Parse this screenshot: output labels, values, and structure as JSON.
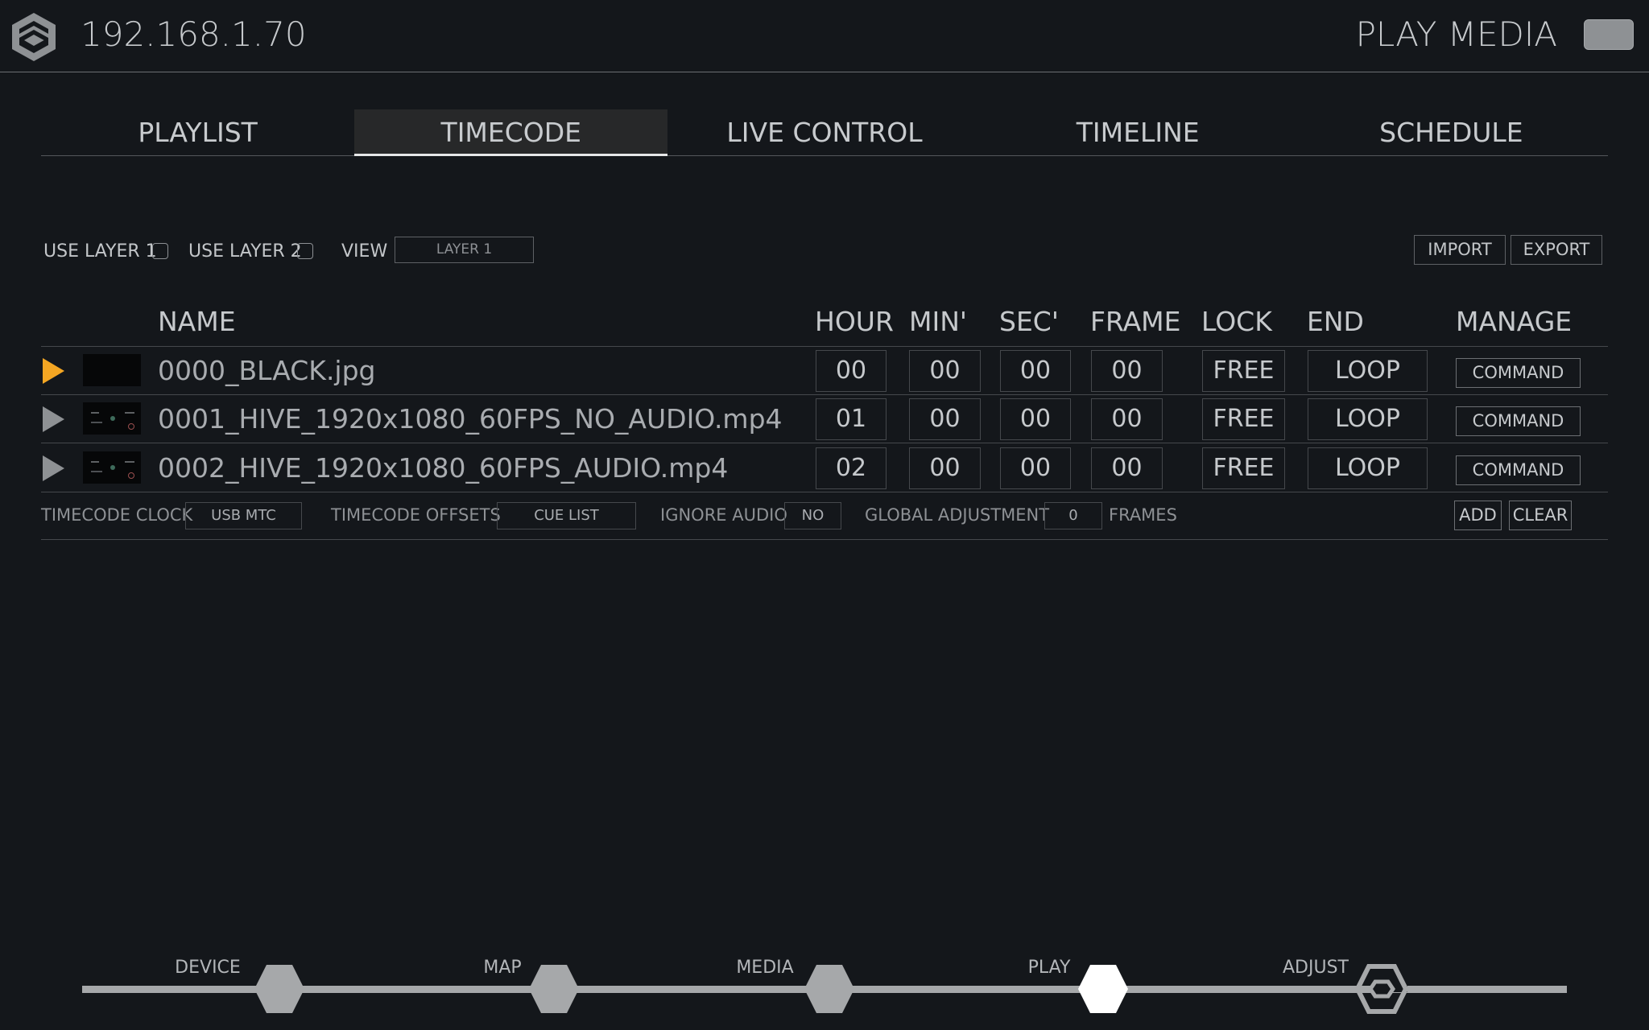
{
  "header": {
    "ip": "192.168.1.70",
    "title": "PLAY MEDIA"
  },
  "tabs": [
    {
      "label": "PLAYLIST",
      "active": false
    },
    {
      "label": "TIMECODE",
      "active": true
    },
    {
      "label": "LIVE CONTROL",
      "active": false
    },
    {
      "label": "TIMELINE",
      "active": false
    },
    {
      "label": "SCHEDULE",
      "active": false
    }
  ],
  "options": {
    "use_layer_1": "USE LAYER 1",
    "use_layer_2": "USE LAYER 2",
    "view_label": "VIEW",
    "view_value": "LAYER 1",
    "import": "IMPORT",
    "export": "EXPORT"
  },
  "table": {
    "headers": {
      "name": "NAME",
      "hour": "HOUR",
      "min": "MIN'",
      "sec": "SEC'",
      "frame": "FRAME",
      "lock": "LOCK",
      "end": "END",
      "manage": "MANAGE"
    },
    "rows": [
      {
        "name": "0000_BLACK.jpg",
        "hour": "00",
        "min": "00",
        "sec": "00",
        "frame": "00",
        "lock": "FREE",
        "end": "LOOP",
        "manage": "COMMAND",
        "playing": true
      },
      {
        "name": "0001_HIVE_1920x1080_60FPS_NO_AUDIO.mp4",
        "hour": "01",
        "min": "00",
        "sec": "00",
        "frame": "00",
        "lock": "FREE",
        "end": "LOOP",
        "manage": "COMMAND",
        "playing": false
      },
      {
        "name": "0002_HIVE_1920x1080_60FPS_AUDIO.mp4",
        "hour": "02",
        "min": "00",
        "sec": "00",
        "frame": "00",
        "lock": "FREE",
        "end": "LOOP",
        "manage": "COMMAND",
        "playing": false
      }
    ]
  },
  "controls": {
    "timecode_clock_label": "TIMECODE CLOCK",
    "timecode_clock_value": "USB MTC",
    "timecode_offsets_label": "TIMECODE OFFSETS",
    "timecode_offsets_value": "CUE LIST",
    "ignore_audio_label": "IGNORE AUDIO",
    "ignore_audio_value": "NO",
    "global_adjustment_label": "GLOBAL ADJUSTMENT",
    "global_adjustment_value": "0",
    "frames_label": "FRAMES",
    "add": "ADD",
    "clear": "CLEAR"
  },
  "bottom_nav": [
    {
      "label": "DEVICE",
      "state": "inactive"
    },
    {
      "label": "MAP",
      "state": "inactive"
    },
    {
      "label": "MEDIA",
      "state": "inactive"
    },
    {
      "label": "PLAY",
      "state": "active"
    },
    {
      "label": "ADJUST",
      "state": "outline"
    }
  ],
  "colors": {
    "background": "#14171b",
    "accent_play": "#f4a623",
    "active_hex": "#ffffff",
    "inactive_hex": "#a6a8aa"
  }
}
